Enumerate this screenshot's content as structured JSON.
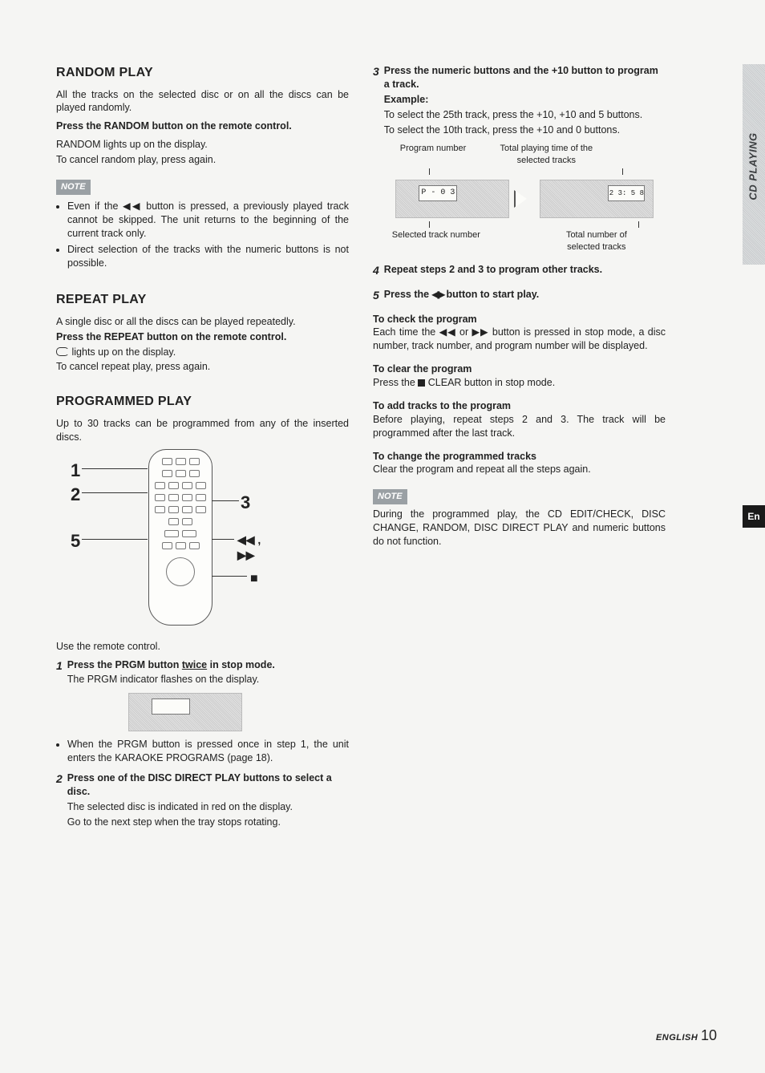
{
  "sideTab": "CD PLAYING",
  "langTab": "En",
  "footer": {
    "lang": "ENGLISH",
    "page": "10"
  },
  "left": {
    "random": {
      "heading": "RANDOM PLAY",
      "p1": "All the tracks on the selected disc or on all the discs can be played randomly.",
      "p2": "Press the RANDOM button on the remote control.",
      "p3": "RANDOM lights up on the display.",
      "p4": "To cancel random play, press again.",
      "noteLabel": "NOTE",
      "note1": "Even if the ◀◀ button is pressed, a previously played track cannot be skipped. The unit returns to the beginning of the current track only.",
      "note2": "Direct selection of the tracks with the numeric buttons is not possible."
    },
    "repeat": {
      "heading": "REPEAT PLAY",
      "p1": "A single disc or all the discs can be played repeatedly.",
      "p2": "Press the REPEAT button on the remote control.",
      "p3a": "lights up on the display.",
      "p4": "To cancel repeat play, press again."
    },
    "programmed": {
      "heading": "PROGRAMMED PLAY",
      "intro": "Up to 30 tracks can be programmed from any of the inserted discs.",
      "callouts": {
        "c1": "1",
        "c2": "2",
        "c3": "3",
        "c5": "5",
        "rw": "◀◀ , ▶▶",
        "stop": "■"
      },
      "useRemote": "Use the remote control.",
      "step1": {
        "num": "1",
        "title_a": "Press the PRGM button ",
        "title_u": "twice",
        "title_b": " in stop mode.",
        "sub": "The PRGM indicator flashes on the display.",
        "bullet": "When the PRGM button is pressed once in step 1, the unit enters the KARAOKE PROGRAMS (page 18)."
      },
      "step2": {
        "num": "2",
        "title": "Press one of the DISC DIRECT PLAY buttons to select a disc.",
        "sub1": "The selected disc is indicated in red on the display.",
        "sub2": "Go to the next step when the tray stops rotating."
      }
    }
  },
  "right": {
    "step3": {
      "num": "3",
      "title": "Press the numeric buttons and the +10 button to program a track.",
      "exLabel": "Example:",
      "ex1": "To select the 25th track, press the +10, +10 and 5 buttons.",
      "ex2": "To select the 10th track, press the +10 and 0 buttons.",
      "lblProgNum": "Program number",
      "lblTotalTime": "Total playing time of the selected tracks",
      "lblSelTrack": "Selected track number",
      "lblTotalTracks": "Total number of selected tracks",
      "lcd1a": "P - 0 3",
      "lcd2a": "2 3: 5 8"
    },
    "step4": {
      "num": "4",
      "title": "Repeat steps 2 and 3 to program other tracks."
    },
    "step5": {
      "num": "5",
      "title_a": "Press the ",
      "title_b": " button to start play.",
      "icon": "◀▶"
    },
    "check": {
      "h": "To check the program",
      "p": "Each time the ◀◀ or ▶▶ button is pressed in stop mode, a disc number, track number, and program number will be displayed."
    },
    "clear": {
      "h": "To clear the program",
      "p_a": "Press the ",
      "p_b": " CLEAR button in stop mode."
    },
    "add": {
      "h": "To add tracks to the program",
      "p": "Before playing, repeat steps 2 and 3. The track will be programmed after the last track."
    },
    "change": {
      "h": "To change the programmed tracks",
      "p": "Clear the program and repeat all the steps again."
    },
    "noteLabel": "NOTE",
    "noteP": "During the programmed play, the CD EDIT/CHECK, DISC CHANGE, RANDOM, DISC DIRECT PLAY and numeric buttons do not function."
  }
}
